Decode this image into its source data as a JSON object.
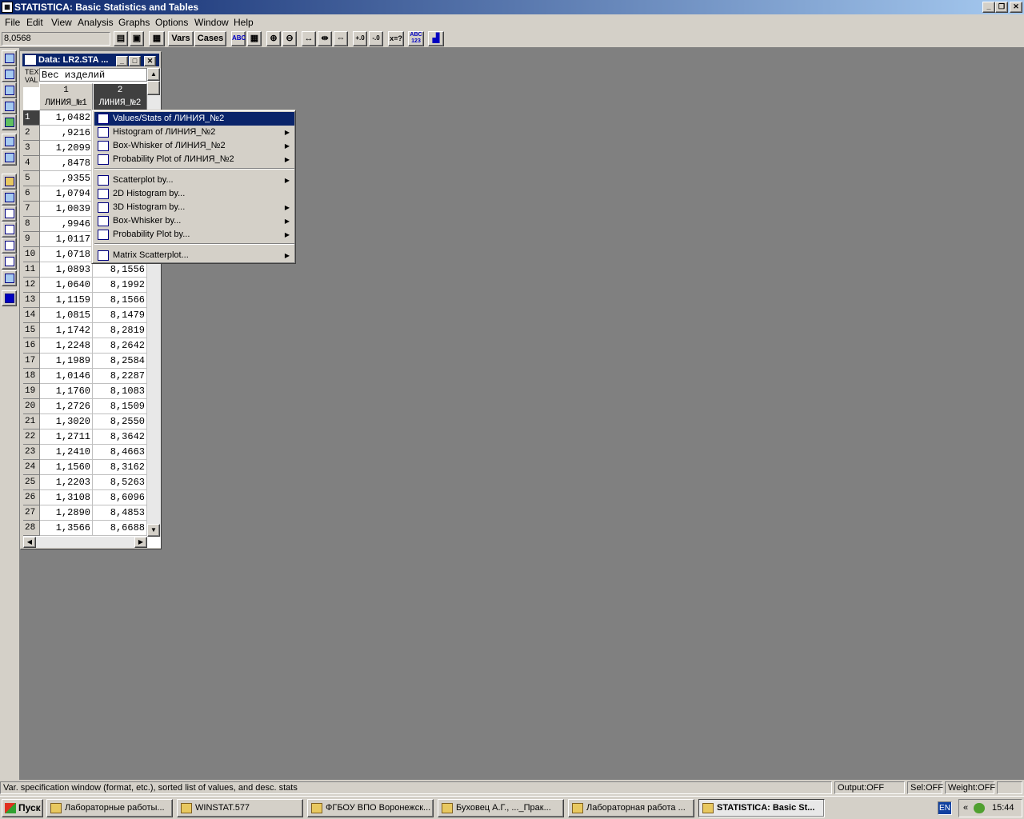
{
  "app": {
    "title": "STATISTICA: Basic Statistics and Tables",
    "icon": "statistica-app-icon"
  },
  "window_buttons": {
    "minimize": "_",
    "restore": "❐",
    "close": "✕"
  },
  "menubar": [
    "File",
    "Edit",
    "View",
    "Analysis",
    "Graphs",
    "Options",
    "Window",
    "Help"
  ],
  "toolbar": {
    "cell_value": "8,0568",
    "vars_label": "Vars",
    "cases_label": "Cases",
    "x2_label": "x=?",
    "abc_label": "ABC 123"
  },
  "data_window": {
    "title": "Data: LR2.STA ...",
    "text_label_1": "TEXT",
    "text_label_2": "VAL",
    "var_name_field": "Вес изделий",
    "columns": [
      {
        "num": "1",
        "name": "ЛИНИЯ_№1"
      },
      {
        "num": "2",
        "name": "ЛИНИЯ_№2"
      }
    ],
    "rows": [
      {
        "n": "1",
        "c1": "1,0482",
        "c2": ""
      },
      {
        "n": "2",
        "c1": ",9216",
        "c2": ""
      },
      {
        "n": "3",
        "c1": "1,2099",
        "c2": ""
      },
      {
        "n": "4",
        "c1": ",8478",
        "c2": ""
      },
      {
        "n": "5",
        "c1": ",9355",
        "c2": ""
      },
      {
        "n": "6",
        "c1": "1,0794",
        "c2": ""
      },
      {
        "n": "7",
        "c1": "1,0039",
        "c2": ""
      },
      {
        "n": "8",
        "c1": ",9946",
        "c2": ""
      },
      {
        "n": "9",
        "c1": "1,0117",
        "c2": ""
      },
      {
        "n": "10",
        "c1": "1,0718",
        "c2": ""
      },
      {
        "n": "11",
        "c1": "1,0893",
        "c2": "8,1556"
      },
      {
        "n": "12",
        "c1": "1,0640",
        "c2": "8,1992"
      },
      {
        "n": "13",
        "c1": "1,1159",
        "c2": "8,1566"
      },
      {
        "n": "14",
        "c1": "1,0815",
        "c2": "8,1479"
      },
      {
        "n": "15",
        "c1": "1,1742",
        "c2": "8,2819"
      },
      {
        "n": "16",
        "c1": "1,2248",
        "c2": "8,2642"
      },
      {
        "n": "17",
        "c1": "1,1989",
        "c2": "8,2584"
      },
      {
        "n": "18",
        "c1": "1,0146",
        "c2": "8,2287"
      },
      {
        "n": "19",
        "c1": "1,1760",
        "c2": "8,1083"
      },
      {
        "n": "20",
        "c1": "1,2726",
        "c2": "8,1509"
      },
      {
        "n": "21",
        "c1": "1,3020",
        "c2": "8,2550"
      },
      {
        "n": "22",
        "c1": "1,2711",
        "c2": "8,3642"
      },
      {
        "n": "23",
        "c1": "1,2410",
        "c2": "8,4663"
      },
      {
        "n": "24",
        "c1": "1,1560",
        "c2": "8,3162"
      },
      {
        "n": "25",
        "c1": "1,2203",
        "c2": "8,5263"
      },
      {
        "n": "26",
        "c1": "1,3108",
        "c2": "8,6096"
      },
      {
        "n": "27",
        "c1": "1,2890",
        "c2": "8,4853"
      },
      {
        "n": "28",
        "c1": "1,3566",
        "c2": "8,6688"
      }
    ]
  },
  "context_menu": {
    "items": [
      {
        "label": "Values/Stats of ЛИНИЯ_№2",
        "icon": "values-stats-icon",
        "submenu": false,
        "highlighted": true
      },
      {
        "label": "Histogram of ЛИНИЯ_№2",
        "icon": "histogram-icon",
        "submenu": true
      },
      {
        "label": "Box-Whisker of ЛИНИЯ_№2",
        "icon": "box-whisker-icon",
        "submenu": true
      },
      {
        "label": "Probability Plot of ЛИНИЯ_№2",
        "icon": "probability-plot-icon",
        "submenu": true
      },
      {
        "label": "Scatterplot by...",
        "icon": "scatterplot-icon",
        "submenu": true
      },
      {
        "label": "2D Histogram by...",
        "icon": "histogram-2d-icon",
        "submenu": false
      },
      {
        "label": "3D Histogram by...",
        "icon": "histogram-3d-icon",
        "submenu": true
      },
      {
        "label": "Box-Whisker by...",
        "icon": "box-whisker-by-icon",
        "submenu": true
      },
      {
        "label": "Probability Plot by...",
        "icon": "probability-plot-by-icon",
        "submenu": true
      },
      {
        "label": "Matrix Scatterplot...",
        "icon": "matrix-scatterplot-icon",
        "submenu": true
      }
    ]
  },
  "statusbar": {
    "message": "Var. specification window (format, etc.), sorted list of values, and desc. stats",
    "output": "Output:OFF",
    "sel": "Sel:OFF",
    "weight": "Weight:OFF"
  },
  "taskbar": {
    "start": "Пуск",
    "tasks": [
      {
        "label": "Лабораторные работы...",
        "icon": "folder-icon"
      },
      {
        "label": "WINSTAT.577",
        "icon": "folder-icon"
      },
      {
        "label": "ФГБОУ ВПО Воронежск...",
        "icon": "chrome-icon"
      },
      {
        "label": "Буховец А.Г., ..._Прак...",
        "icon": "document-icon"
      },
      {
        "label": "Лабораторная работа ...",
        "icon": "word-icon"
      },
      {
        "label": "STATISTICA: Basic St...",
        "icon": "statistica-icon",
        "active": true
      }
    ],
    "lang": "EN",
    "clock": "15:44",
    "chevron": "«"
  }
}
